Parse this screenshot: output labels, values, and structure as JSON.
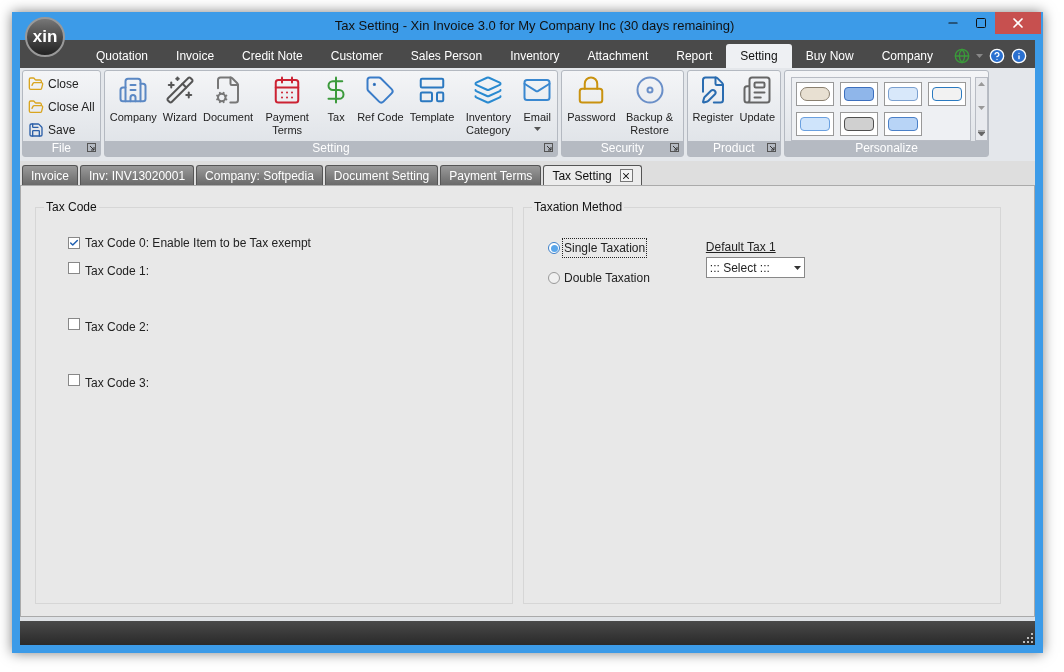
{
  "window": {
    "title": "Tax Setting - Xin Invoice 3.0 for My Company Inc (30 days remaining)",
    "logo": "xin"
  },
  "menu_tabs": [
    {
      "label": "Quotation",
      "selected": false
    },
    {
      "label": "Invoice",
      "selected": false
    },
    {
      "label": "Credit Note",
      "selected": false
    },
    {
      "label": "Customer",
      "selected": false
    },
    {
      "label": "Sales Person",
      "selected": false
    },
    {
      "label": "Inventory",
      "selected": false
    },
    {
      "label": "Attachment",
      "selected": false
    },
    {
      "label": "Report",
      "selected": false
    },
    {
      "label": "Setting",
      "selected": true
    },
    {
      "label": "Buy Now",
      "selected": false
    },
    {
      "label": "Company",
      "selected": false
    }
  ],
  "ribbon": {
    "groups": [
      {
        "label": "File",
        "kind": "small",
        "launcher": true,
        "items": [
          {
            "label": "Close"
          },
          {
            "label": "Close All"
          },
          {
            "label": "Save"
          }
        ]
      },
      {
        "label": "Setting",
        "kind": "large",
        "launcher": true,
        "items": [
          {
            "label": "Company"
          },
          {
            "label": "Wizard"
          },
          {
            "label": "Document"
          },
          {
            "label": "Payment Terms"
          },
          {
            "label": "Tax"
          },
          {
            "label": "Ref Code"
          },
          {
            "label": "Template"
          },
          {
            "label": "Inventory Category"
          },
          {
            "label": "Email",
            "dropdown": true
          }
        ]
      },
      {
        "label": "Security",
        "kind": "large",
        "launcher": true,
        "items": [
          {
            "label": "Password"
          },
          {
            "label": "Backup & Restore"
          }
        ]
      },
      {
        "label": "Product",
        "kind": "large",
        "launcher": true,
        "items": [
          {
            "label": "Register"
          },
          {
            "label": "Update"
          }
        ]
      },
      {
        "label": "Personalize",
        "kind": "gallery",
        "launcher": false
      }
    ]
  },
  "doc_tabs": [
    {
      "label": "Invoice",
      "selected": false
    },
    {
      "label": "Inv: INV13020001",
      "selected": false
    },
    {
      "label": "Company: Softpedia",
      "selected": false
    },
    {
      "label": "Document Setting",
      "selected": false
    },
    {
      "label": "Payment Terms",
      "selected": false
    },
    {
      "label": "Tax Setting",
      "selected": true
    }
  ],
  "tax_code": {
    "title": "Tax Code",
    "items": [
      {
        "label": "Tax Code 0: Enable Item to be Tax exempt",
        "checked": true
      },
      {
        "label": "Tax Code 1:",
        "checked": false
      },
      {
        "label": "Tax Code 2:",
        "checked": false
      },
      {
        "label": "Tax Code 3:",
        "checked": false
      }
    ]
  },
  "taxation_method": {
    "title": "Taxation Method",
    "options": [
      {
        "label": "Single Taxation",
        "selected": true,
        "focused": true
      },
      {
        "label": "Double Taxation",
        "selected": false,
        "focused": false
      }
    ],
    "default_tax": {
      "label": "Default Tax 1",
      "value": "::: Select :::"
    }
  }
}
